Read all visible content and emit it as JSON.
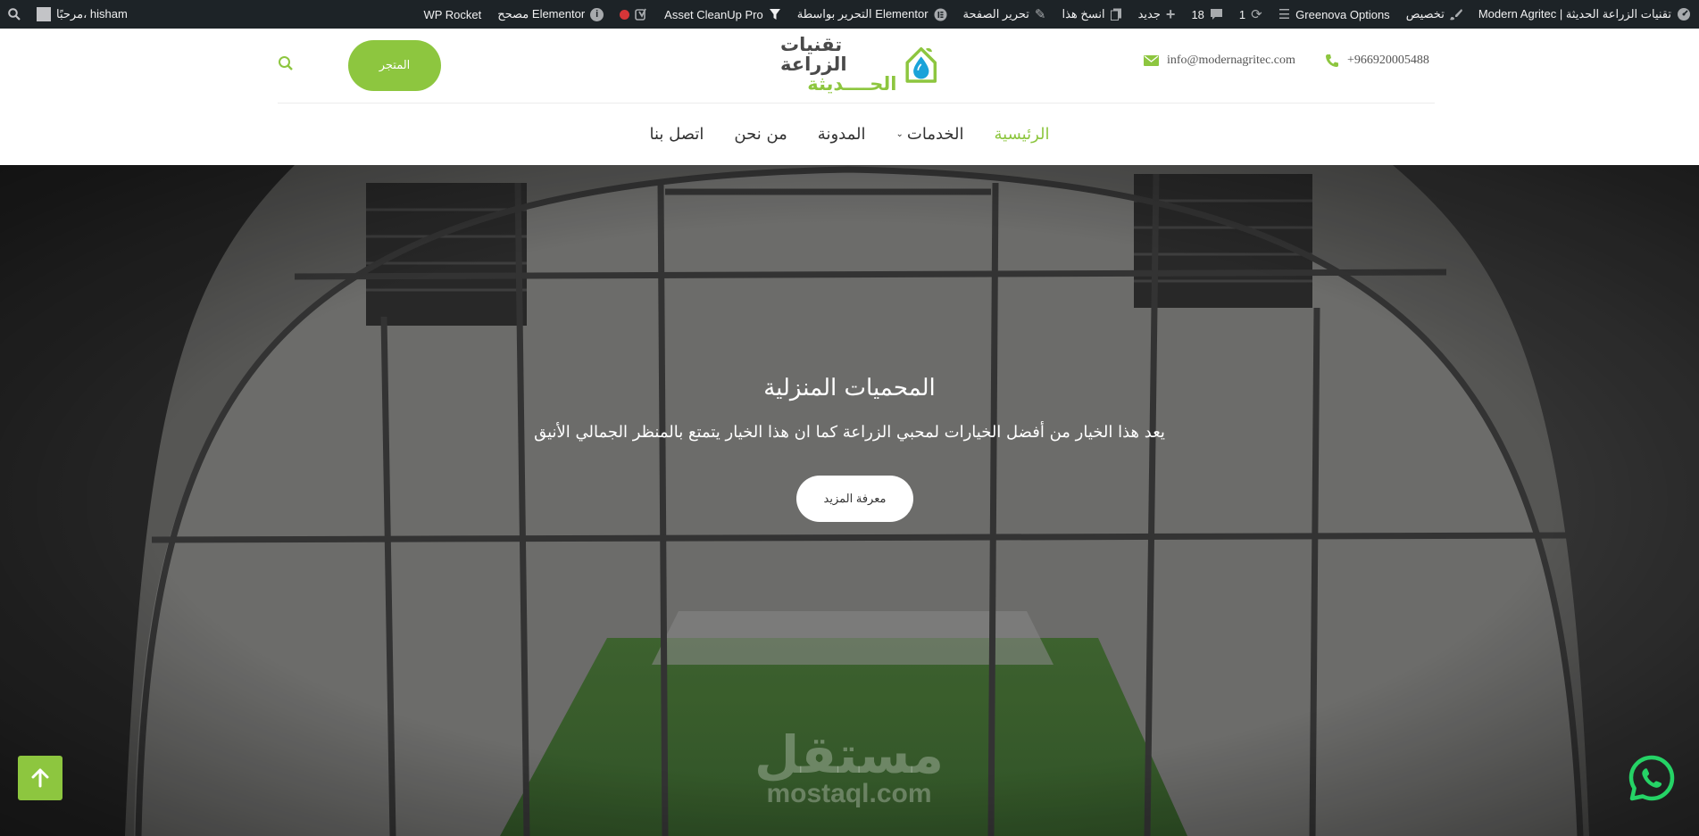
{
  "admin_bar": {
    "site_name": "Modern Agritec | تقنيات الزراعة الحديثة",
    "customize": "تخصيص",
    "theme_options": "Greenova Options",
    "updates_count": "1",
    "comments_count": "18",
    "new": "جديد",
    "copy": "انسخ هذا",
    "edit_page": "تحرير الصفحة",
    "edit_elementor": "التحرير بواسطة Elementor",
    "asset_cleanup": "Asset CleanUp Pro",
    "elementor_debugger": "مصحح Elementor",
    "wp_rocket": "WP Rocket",
    "greeting": "مرحبًا، hisham"
  },
  "header": {
    "phone": "+966920005488",
    "email": "info@modernagritec.com",
    "logo_line1": "تقنيات الزراعة",
    "logo_line2": "الحــــديثة",
    "shop_label": "المتجر"
  },
  "nav": {
    "items": [
      {
        "label": "الرئيسية",
        "active": true
      },
      {
        "label": "الخدمات",
        "has_dropdown": true
      },
      {
        "label": "المدونة"
      },
      {
        "label": "من نحن"
      },
      {
        "label": "اتصل بنا"
      }
    ]
  },
  "hero": {
    "title": "المحميات المنزلية",
    "subtitle": "يعد هذا الخيار من أفضل الخيارات لمحبي الزراعة كما ان هذا الخيار يتمتع بالمنظر الجمالي الأنيق",
    "button": "معرفة المزيد"
  },
  "watermark": {
    "arabic": "مستقل",
    "latin": "mostaql.com"
  },
  "colors": {
    "accent": "#8dc63f",
    "admin_bar": "#1d2327",
    "text_dark": "#333333"
  }
}
